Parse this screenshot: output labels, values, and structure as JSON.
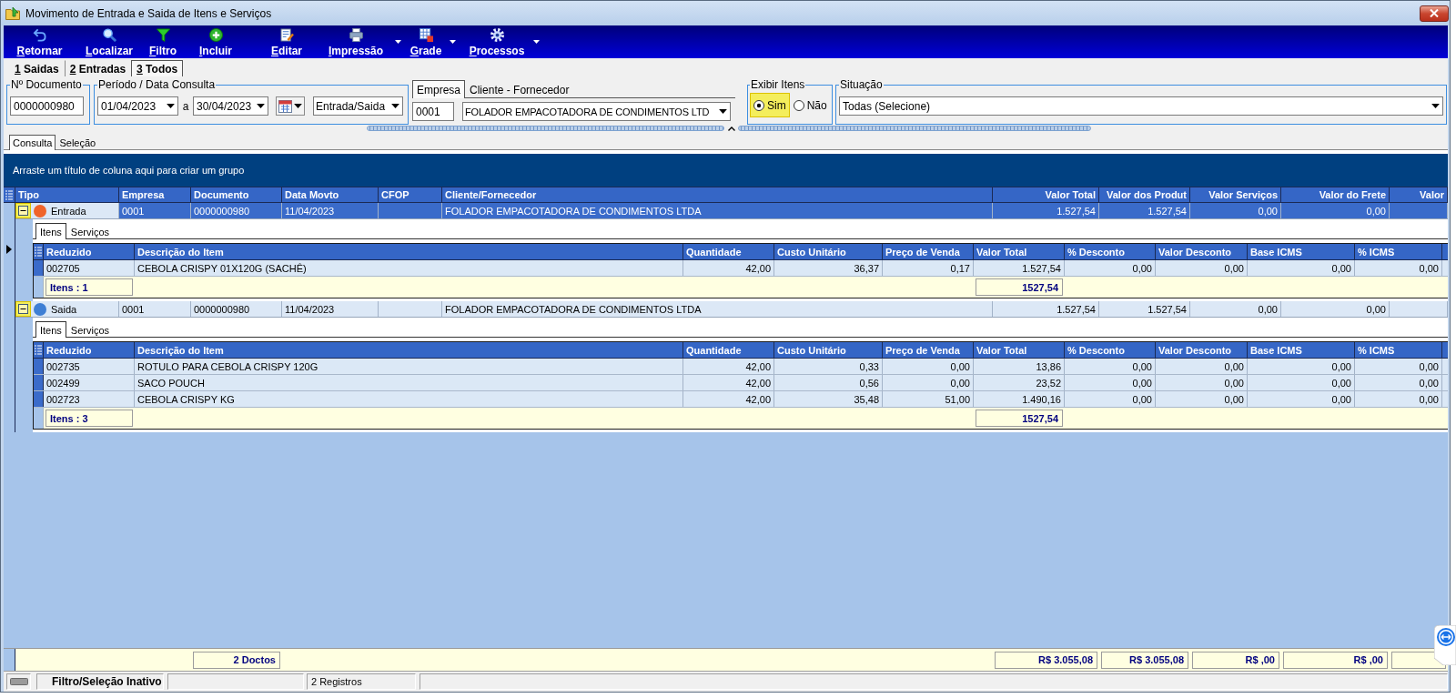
{
  "window": {
    "title": "Movimento de Entrada e Saida de Itens e Serviços"
  },
  "toolbar": [
    {
      "label": "Retornar",
      "kind": "button"
    },
    {
      "label": "Localizar",
      "kind": "button"
    },
    {
      "label": "Filtro",
      "kind": "button"
    },
    {
      "label": "Incluir",
      "kind": "button"
    },
    {
      "label": "Editar",
      "kind": "button"
    },
    {
      "label": "Impressão",
      "kind": "dropdown"
    },
    {
      "label": "Grade",
      "kind": "dropdown"
    },
    {
      "label": "Processos",
      "kind": "dropdown"
    }
  ],
  "mode_tabs": [
    {
      "label": "1 Saidas",
      "selected": false
    },
    {
      "label": "2 Entradas",
      "selected": false
    },
    {
      "label": "3 Todos",
      "selected": true
    }
  ],
  "filters": {
    "documento": {
      "legend": "Nº Documento",
      "value": "0000000980"
    },
    "periodo": {
      "legend": "Período / Data Consulta",
      "start": "01/04/2023",
      "separator": "a",
      "end": "30/04/2023",
      "movement": "Entrada/Saida"
    },
    "party_tabs": [
      {
        "label": "Empresa",
        "selected": true
      },
      {
        "label": "Cliente - Fornecedor",
        "selected": false
      }
    ],
    "empresa": {
      "code": "0001",
      "name": "FOLADOR EMPACOTADORA DE CONDIMENTOS LTD"
    },
    "exibir_itens": {
      "legend": "Exibir Itens",
      "options": [
        {
          "label": "Sim",
          "selected": true,
          "highlighted": true
        },
        {
          "label": "Não",
          "selected": false,
          "highlighted": false
        }
      ]
    },
    "situacao": {
      "legend": "Situação",
      "value": "Todas (Selecione)"
    }
  },
  "view_tabs": [
    {
      "label": "Consulta",
      "selected": true
    },
    {
      "label": "Seleção",
      "selected": false
    }
  ],
  "grid": {
    "group_hint": "Arraste um título de coluna aqui para criar um grupo",
    "columns": [
      {
        "label": "Tipo",
        "kind": "text"
      },
      {
        "label": "Empresa",
        "kind": "text"
      },
      {
        "label": "Documento",
        "kind": "text"
      },
      {
        "label": "Data Movto",
        "kind": "text"
      },
      {
        "label": "CFOP",
        "kind": "text"
      },
      {
        "label": "Cliente/Fornecedor",
        "kind": "text"
      },
      {
        "label": "Valor Total",
        "kind": "number"
      },
      {
        "label": "Valor dos Produt",
        "kind": "number"
      },
      {
        "label": "Valor Serviços",
        "kind": "number"
      },
      {
        "label": "Valor do Frete",
        "kind": "number"
      },
      {
        "label": "Valor",
        "kind": "number"
      }
    ],
    "rows": [
      {
        "color": "#f0642a",
        "selected": true,
        "expanded": true,
        "highlighted": true,
        "cells": [
          "Entrada",
          "0001",
          "0000000980",
          "11/04/2023",
          "",
          "FOLADOR EMPACOTADORA DE CONDIMENTOS LTDA",
          "1.527,54",
          "1.527,54",
          "0,00",
          "0,00"
        ],
        "detail": {
          "tabs": [
            {
              "label": "Itens",
              "selected": true
            },
            {
              "label": "Serviços",
              "selected": false
            }
          ],
          "columns": [
            {
              "label": "Reduzido",
              "kind": "text"
            },
            {
              "label": "Descrição do Item",
              "kind": "text"
            },
            {
              "label": "Quantidade",
              "kind": "number"
            },
            {
              "label": "Custo Unitário",
              "kind": "number"
            },
            {
              "label": "Preço de Venda",
              "kind": "number"
            },
            {
              "label": "Valor Total",
              "kind": "number"
            },
            {
              "label": "% Desconto",
              "kind": "number"
            },
            {
              "label": "Valor Desconto",
              "kind": "number"
            },
            {
              "label": "Base ICMS",
              "kind": "number"
            },
            {
              "label": "% ICMS",
              "kind": "number"
            }
          ],
          "rows": [
            [
              "002705",
              "CEBOLA CRISPY 01X120G (SACHÊ)",
              "42,00",
              "36,37",
              "0,17",
              "1.527,54",
              "0,00",
              "0,00",
              "0,00",
              "0,00"
            ]
          ],
          "footer": {
            "count": "Itens : 1",
            "total": "1527,54"
          }
        }
      },
      {
        "color": "#3f7fd4",
        "selected": false,
        "expanded": true,
        "highlighted": true,
        "cells": [
          "Saida",
          "0001",
          "0000000980",
          "11/04/2023",
          "",
          "FOLADOR EMPACOTADORA DE CONDIMENTOS LTDA",
          "1.527,54",
          "1.527,54",
          "0,00",
          "0,00"
        ],
        "detail": {
          "tabs": [
            {
              "label": "Itens",
              "selected": true
            },
            {
              "label": "Serviços",
              "selected": false
            }
          ],
          "columns": [
            {
              "label": "Reduzido",
              "kind": "text"
            },
            {
              "label": "Descrição do Item",
              "kind": "text"
            },
            {
              "label": "Quantidade",
              "kind": "number"
            },
            {
              "label": "Custo Unitário",
              "kind": "number"
            },
            {
              "label": "Preço de Venda",
              "kind": "number"
            },
            {
              "label": "Valor Total",
              "kind": "number"
            },
            {
              "label": "% Desconto",
              "kind": "number"
            },
            {
              "label": "Valor Desconto",
              "kind": "number"
            },
            {
              "label": "Base ICMS",
              "kind": "number"
            },
            {
              "label": "% ICMS",
              "kind": "number"
            }
          ],
          "rows": [
            [
              "002735",
              "ROTULO PARA CEBOLA CRISPY 120G",
              "42,00",
              "0,33",
              "0,00",
              "13,86",
              "0,00",
              "0,00",
              "0,00",
              "0,00"
            ],
            [
              "002499",
              "SACO POUCH",
              "42,00",
              "0,56",
              "0,00",
              "23,52",
              "0,00",
              "0,00",
              "0,00",
              "0,00"
            ],
            [
              "002723",
              "CEBOLA CRISPY KG",
              "42,00",
              "35,48",
              "51,00",
              "1.490,16",
              "0,00",
              "0,00",
              "0,00",
              "0,00"
            ]
          ],
          "footer": {
            "count": "Itens : 3",
            "total": "1527,54"
          }
        }
      }
    ],
    "summary": {
      "count": "2 Doctos",
      "totals": [
        "R$ 3.055,08",
        "R$ 3.055,08",
        "R$ ,00",
        "R$ ,00"
      ]
    }
  },
  "status_bar": {
    "filter_state": "Filtro/Seleção Inativo",
    "records": "2 Registros"
  }
}
